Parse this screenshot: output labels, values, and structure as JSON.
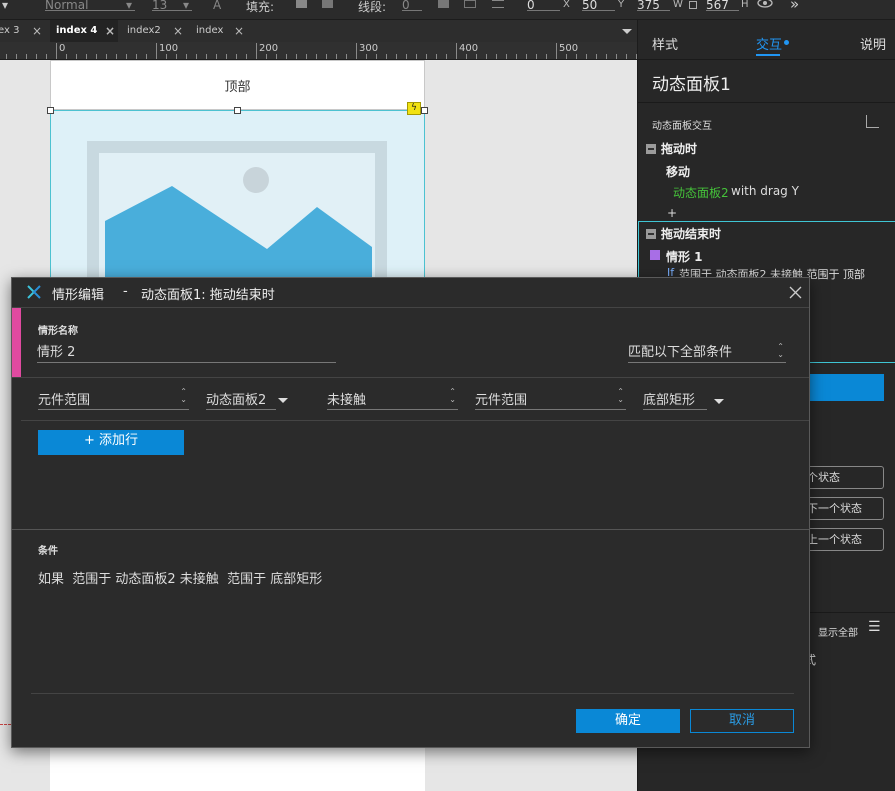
{
  "toolbar": {
    "font_style": "Normal",
    "font_size": "13",
    "fill_label": "填充:",
    "stroke_label": "线段:",
    "stroke_value": "0",
    "x_value": "0",
    "x_label": "X",
    "y_value": "50",
    "y_label": "Y",
    "w_value": "375",
    "w_label": "W",
    "h_value": "567",
    "h_label": "H"
  },
  "tabs": [
    {
      "label": "ex 3"
    },
    {
      "label": "index 4"
    },
    {
      "label": "index2"
    },
    {
      "label": "index"
    }
  ],
  "ruler": {
    "labels": [
      "0",
      "100",
      "200",
      "300",
      "400",
      "500"
    ]
  },
  "canvas": {
    "top_label": "顶部"
  },
  "inspector": {
    "tabs": {
      "style": "样式",
      "interaction": "交互",
      "notes": "说明"
    },
    "panel_name": "动态面板1",
    "section_title": "动态面板交互",
    "events": {
      "drag": "拖动时",
      "move_action": "移动",
      "move_target": "动态面板2",
      "move_detail": "with drag Y",
      "add": "+",
      "drag_end": "拖动结束时",
      "case1": "情形 1",
      "case1_if": "If",
      "case1_condition": "范围于 动态面板2 未接触  范围于 顶部"
    },
    "state_buttons": [
      "个状态",
      "下一个状态",
      "上一个状态"
    ],
    "show_all": "显示全部",
    "partial_text": "式"
  },
  "dialog": {
    "title": "情形编辑",
    "separator": "-",
    "subtitle": "动态面板1: 拖动结束时",
    "case_name_label": "情形名称",
    "case_name_value": "情形 2",
    "match_select": "匹配以下全部条件",
    "condition_row": {
      "c1": "元件范围",
      "c2": "动态面板2",
      "c3": "未接触",
      "c4": "元件范围",
      "c5": "底部矩形"
    },
    "add_row_button": "+ 添加行",
    "conditions_label": "条件",
    "conditions_text": "如果  范围于 动态面板2 未接触  范围于 底部矩形",
    "ok_button": "确定",
    "cancel_button": "取消"
  },
  "colors": {
    "accent": "#0a88d6",
    "green_text": "#45c23a",
    "case_purple": "#a86ee6",
    "pink_bar": "#e04aa0",
    "selection_cyan": "#4cc2d1",
    "lightning_yellow": "#f1e212"
  }
}
